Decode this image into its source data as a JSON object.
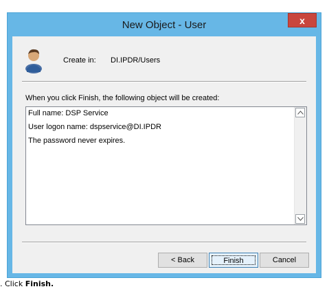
{
  "window": {
    "title": "New Object - User",
    "close_label": "x"
  },
  "header": {
    "create_in_label": "Create in:",
    "create_in_path": "DI.IPDR/Users"
  },
  "info_text": "When you click Finish, the following object will be created:",
  "summary": {
    "lines": [
      "Full name: DSP Service",
      "User logon name: dspservice@DI.IPDR",
      "The password never expires."
    ]
  },
  "buttons": {
    "back": "< Back",
    "finish": "Finish",
    "cancel": "Cancel"
  },
  "caption": {
    "prefix": ". Click",
    "bold": "Finish."
  },
  "colors": {
    "titlebar": "#67b7e6",
    "close": "#c9463d",
    "client": "#f0f0f0"
  }
}
